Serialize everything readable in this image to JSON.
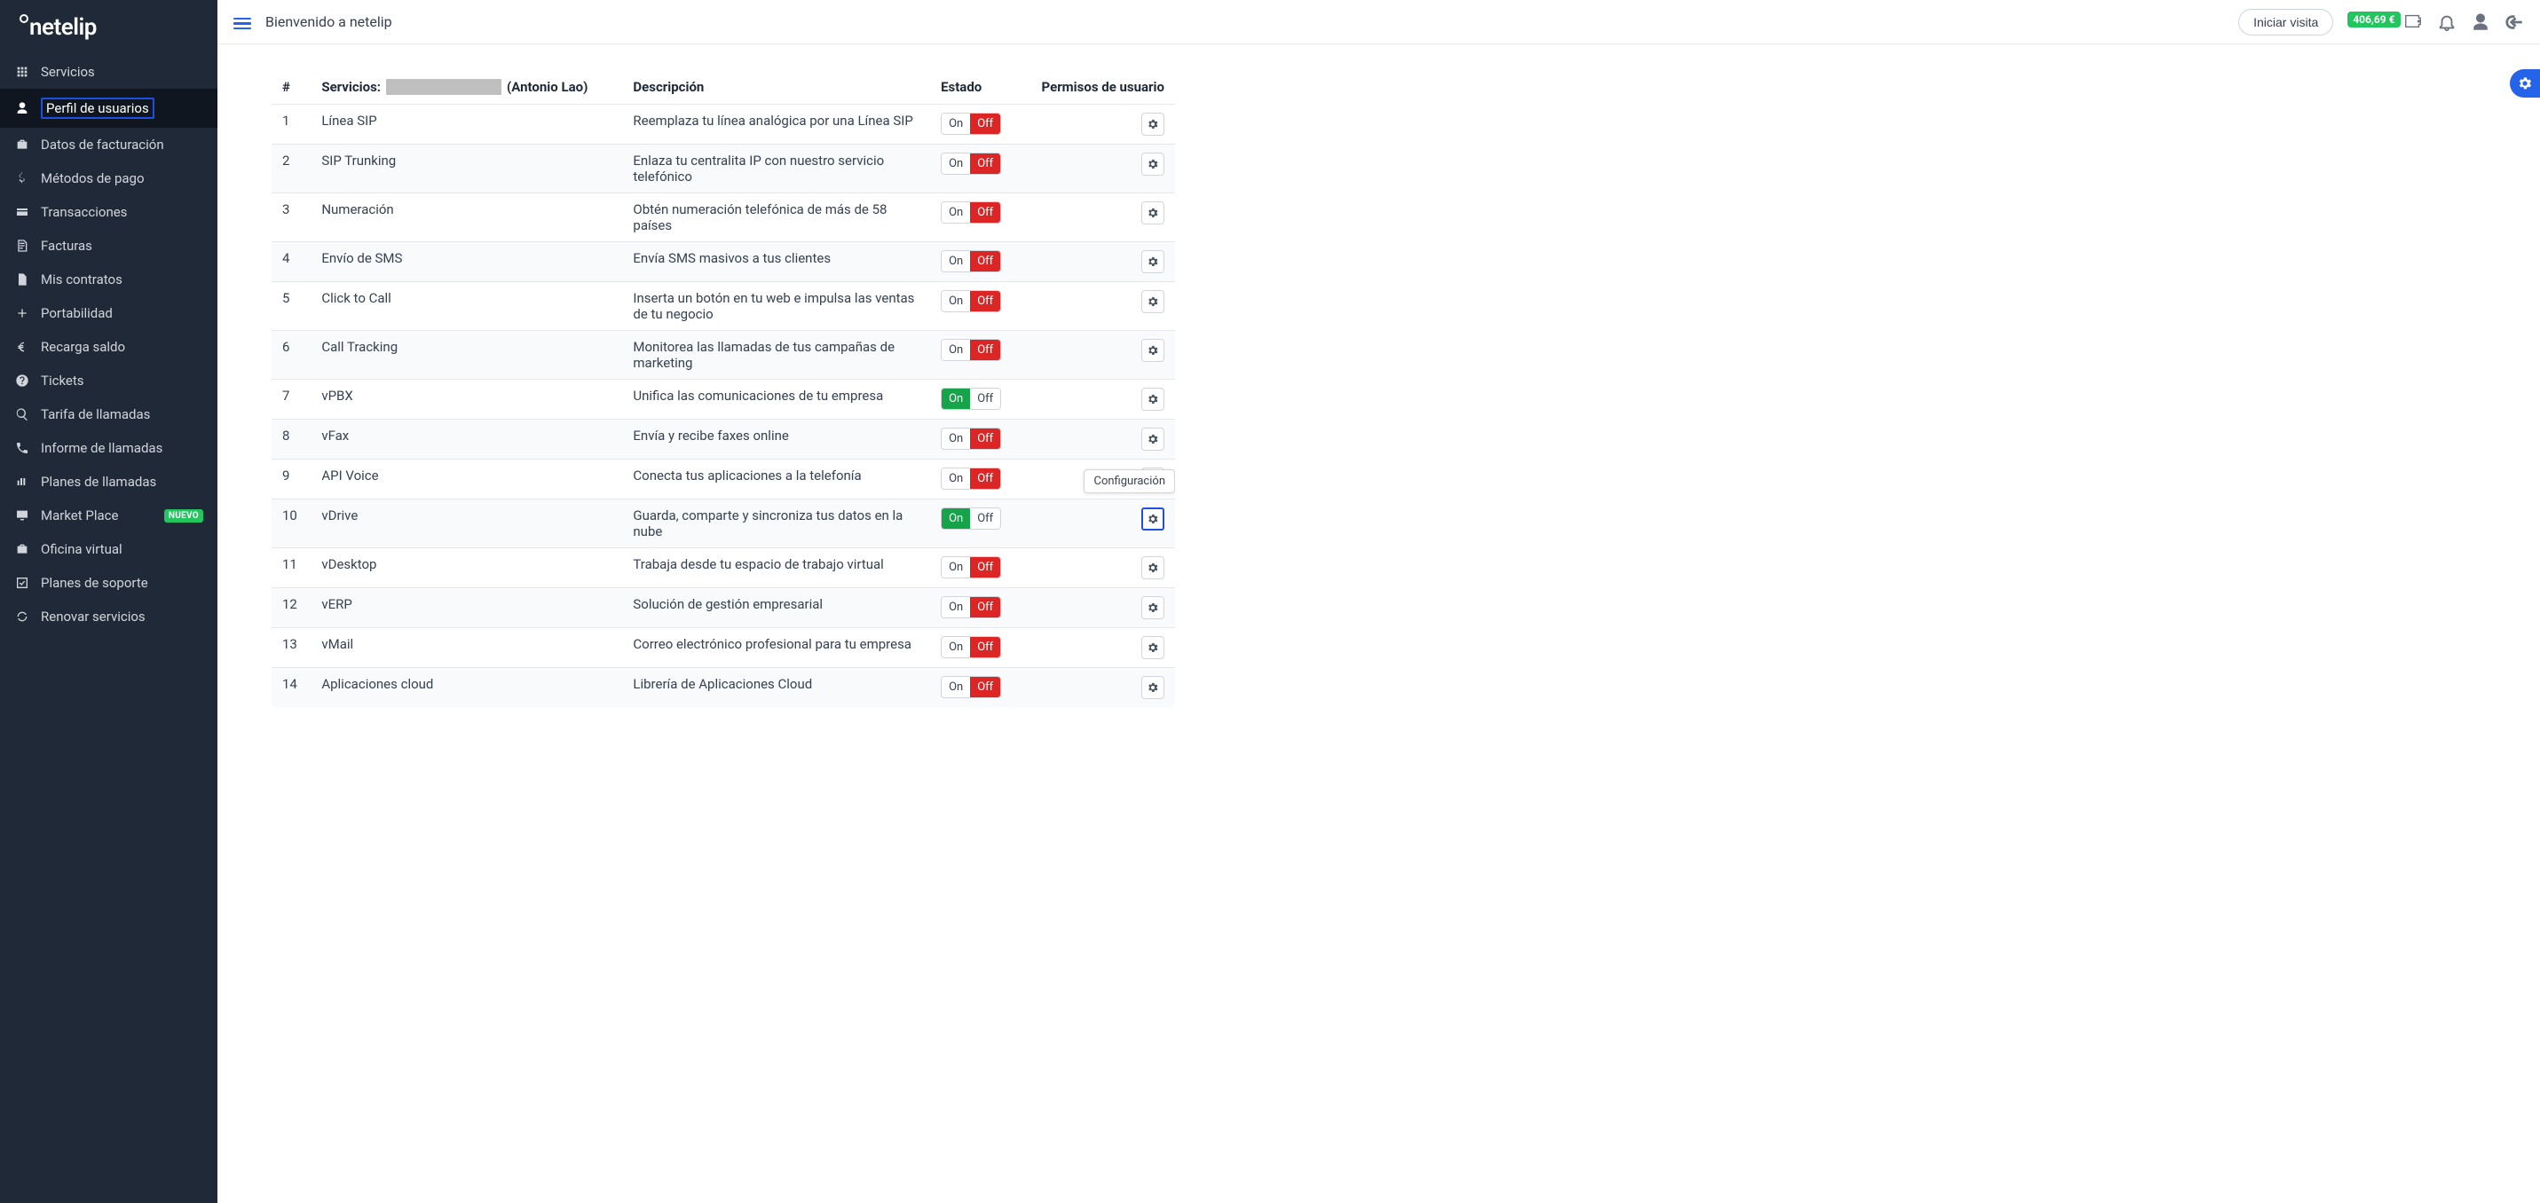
{
  "brand": "netelip",
  "topbar": {
    "welcome": "Bienvenido a netelip",
    "visit_button": "Iniciar visita",
    "balance": "406,69 €"
  },
  "sidebar": [
    {
      "icon": "grid",
      "label": "Servicios"
    },
    {
      "icon": "user",
      "label": "Perfil de usuarios",
      "active": true,
      "highlight": true
    },
    {
      "icon": "briefcase",
      "label": "Datos de facturación"
    },
    {
      "icon": "dollar",
      "label": "Métodos de pago"
    },
    {
      "icon": "card",
      "label": "Transacciones"
    },
    {
      "icon": "doc",
      "label": "Facturas"
    },
    {
      "icon": "file",
      "label": "Mis contratos"
    },
    {
      "icon": "plus",
      "label": "Portabilidad"
    },
    {
      "icon": "euro",
      "label": "Recarga saldo"
    },
    {
      "icon": "question",
      "label": "Tickets"
    },
    {
      "icon": "search",
      "label": "Tarifa de llamadas"
    },
    {
      "icon": "phone",
      "label": "Informe de llamadas"
    },
    {
      "icon": "phonebar",
      "label": "Planes de llamadas"
    },
    {
      "icon": "monitor",
      "label": "Market Place",
      "badge": "NUEVO"
    },
    {
      "icon": "briefcase",
      "label": "Oficina virtual"
    },
    {
      "icon": "check",
      "label": "Planes de soporte"
    },
    {
      "icon": "refresh",
      "label": "Renovar servicios"
    }
  ],
  "table": {
    "headers": {
      "num": "#",
      "services_prefix": "Servicios:",
      "services_user": "(Antonio Lao)",
      "description": "Descripción",
      "status": "Estado",
      "permissions": "Permisos de usuario"
    },
    "toggle": {
      "on": "On",
      "off": "Off"
    },
    "tooltip": "Configuración",
    "rows": [
      {
        "n": "1",
        "name": "Línea SIP",
        "desc": "Reemplaza tu línea analógica por una Línea SIP",
        "state": "off"
      },
      {
        "n": "2",
        "name": "SIP Trunking",
        "desc": "Enlaza tu centralita IP con nuestro servicio telefónico",
        "state": "off"
      },
      {
        "n": "3",
        "name": "Numeración",
        "desc": "Obtén numeración telefónica de más de 58 países",
        "state": "off"
      },
      {
        "n": "4",
        "name": "Envío de SMS",
        "desc": "Envía SMS masivos a tus clientes",
        "state": "off"
      },
      {
        "n": "5",
        "name": "Click to Call",
        "desc": "Inserta un botón en tu web e impulsa las ventas de tu negocio",
        "state": "off"
      },
      {
        "n": "6",
        "name": "Call Tracking",
        "desc": "Monitorea las llamadas de tus campañas de marketing",
        "state": "off"
      },
      {
        "n": "7",
        "name": "vPBX",
        "desc": "Unifica las comunicaciones de tu empresa",
        "state": "on"
      },
      {
        "n": "8",
        "name": "vFax",
        "desc": "Envía y recibe faxes online",
        "state": "off"
      },
      {
        "n": "9",
        "name": "API Voice",
        "desc": "Conecta tus aplicaciones a la telefonía",
        "state": "off"
      },
      {
        "n": "10",
        "name": "vDrive",
        "desc": "Guarda, comparte y sincroniza tus datos en la nube",
        "state": "on",
        "gear_highlight": true,
        "tooltip": true
      },
      {
        "n": "11",
        "name": "vDesktop",
        "desc": "Trabaja desde tu espacio de trabajo virtual",
        "state": "off"
      },
      {
        "n": "12",
        "name": "vERP",
        "desc": "Solución de gestión empresarial",
        "state": "off"
      },
      {
        "n": "13",
        "name": "vMail",
        "desc": "Correo electrónico profesional para tu empresa",
        "state": "off"
      },
      {
        "n": "14",
        "name": "Aplicaciones cloud",
        "desc": "Librería de Aplicaciones Cloud",
        "state": "off"
      }
    ]
  }
}
